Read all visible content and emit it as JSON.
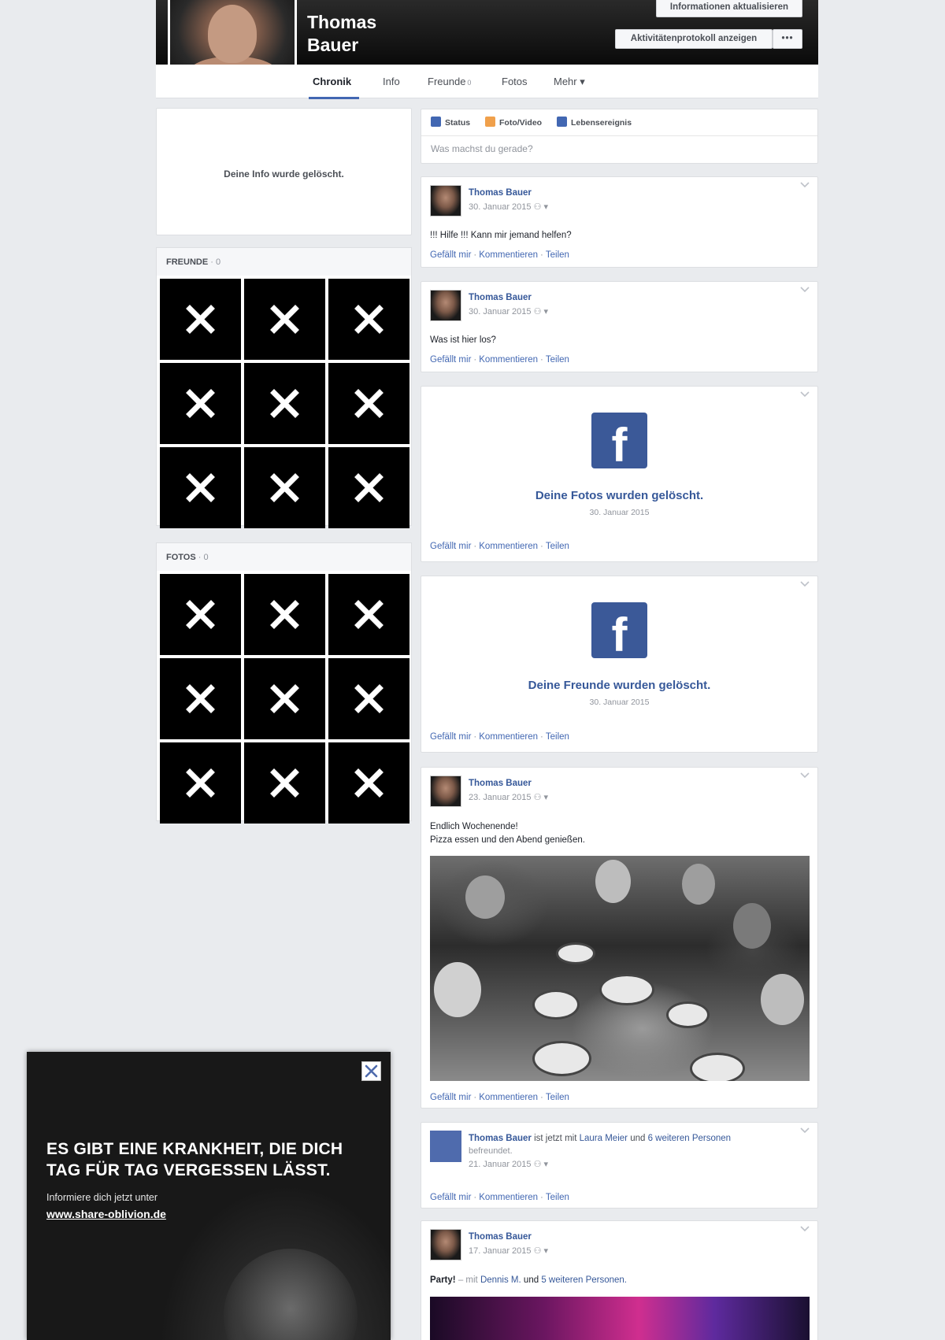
{
  "profile": {
    "name": "Thomas Bauer",
    "buttons": {
      "update_info": "Informationen aktualisieren",
      "activity_log": "Aktivitätenprotokoll anzeigen",
      "more": "•••"
    },
    "tabs": [
      {
        "label": "Chronik",
        "count": ""
      },
      {
        "label": "Info",
        "count": ""
      },
      {
        "label": "Freunde",
        "count": "0"
      },
      {
        "label": "Fotos",
        "count": ""
      },
      {
        "label": "Mehr ▾",
        "count": ""
      }
    ]
  },
  "left": {
    "info_message": "Deine Info wurde gelöscht.",
    "friends": {
      "title": "FREUNDE",
      "count": "· 0"
    },
    "photos": {
      "title": "FOTOS",
      "count": "· 0"
    }
  },
  "composer": {
    "tabs": [
      "Status",
      "Foto/Video",
      "Lebensereignis"
    ],
    "placeholder": "Was machst du gerade?"
  },
  "actions": {
    "like": "Gefällt mir",
    "comment": "Kommentieren",
    "share": "Teilen"
  },
  "posts": [
    {
      "author": "Thomas Bauer",
      "date": "30. Januar 2015",
      "text": "!!! Hilfe !!! Kann mir jemand helfen?"
    },
    {
      "author": "Thomas Bauer",
      "date": "30. Januar 2015",
      "text": "Was ist hier los?"
    },
    {
      "title": "Deine Fotos wurden gelöscht.",
      "date": "30. Januar 2015"
    },
    {
      "title": "Deine Freunde wurden gelöscht.",
      "date": "30. Januar 2015"
    },
    {
      "author": "Thomas Bauer",
      "date": "23. Januar 2015",
      "text_line1": "Endlich Wochenende!",
      "text_line2": "Pizza essen und den Abend genießen."
    },
    {
      "author": "Thomas Bauer",
      "middle": "ist jetzt mit",
      "friend": "Laura Meier",
      "and": "und",
      "others": "6 weiteren Personen",
      "line2": "befreundet.",
      "date": "21. Januar 2015"
    },
    {
      "author": "Thomas Bauer",
      "date": "17. Januar 2015",
      "party": "Party!",
      "with": "– mit",
      "friend": "Dennis M.",
      "and": "und",
      "others": "5 weiteren Personen."
    }
  ],
  "ad": {
    "headline_line1": "ES GIBT EINE KRANKHEIT, DIE DICH",
    "headline_line2": "TAG FÜR TAG VERGESSEN LÄSST.",
    "sub": "Informiere dich jetzt unter",
    "url": "www.share-oblivion.de"
  },
  "colors": {
    "brand": "#3b5998",
    "link": "#365899",
    "background": "#e9ebee"
  }
}
